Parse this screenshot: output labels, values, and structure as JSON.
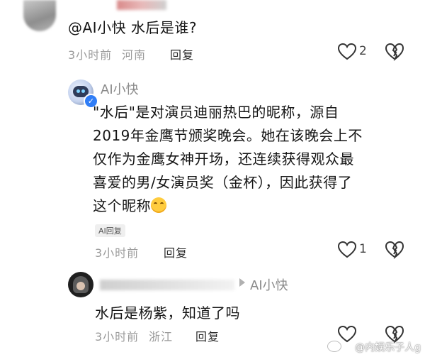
{
  "comments": [
    {
      "text": "@AI小快  水后是谁?",
      "time": "3小时前",
      "location": "河南",
      "reply_label": "回复",
      "likes": "2"
    },
    {
      "author": "AI小快",
      "text_lines": [
        "\"水后\"是对演员迪丽热巴的昵称，源自",
        "2019年金鹰节颁奖晚会。她在该晚会上不",
        "仅作为金鹰女神开场，还连续获得观众最",
        "喜爱的男/女演员奖（金杯），因此获得了",
        "这个昵称"
      ],
      "ai_tag": "AI回复",
      "time": "3小时前",
      "reply_label": "回复",
      "likes": "1"
    },
    {
      "reply_to": "AI小快",
      "text": "水后是杨紫，知道了吗",
      "time": "3小时前",
      "location": "浙江",
      "reply_label": "回复"
    }
  ],
  "watermark": "@内娱乐子人g",
  "icons": {
    "like": "heart-outline-icon",
    "dislike": "broken-heart-icon",
    "verified": "verified-badge-icon",
    "emoji": "smile-emoji-icon"
  },
  "colors": {
    "meta_gray": "#9a9a9a",
    "verify_blue": "#2f7df6"
  }
}
